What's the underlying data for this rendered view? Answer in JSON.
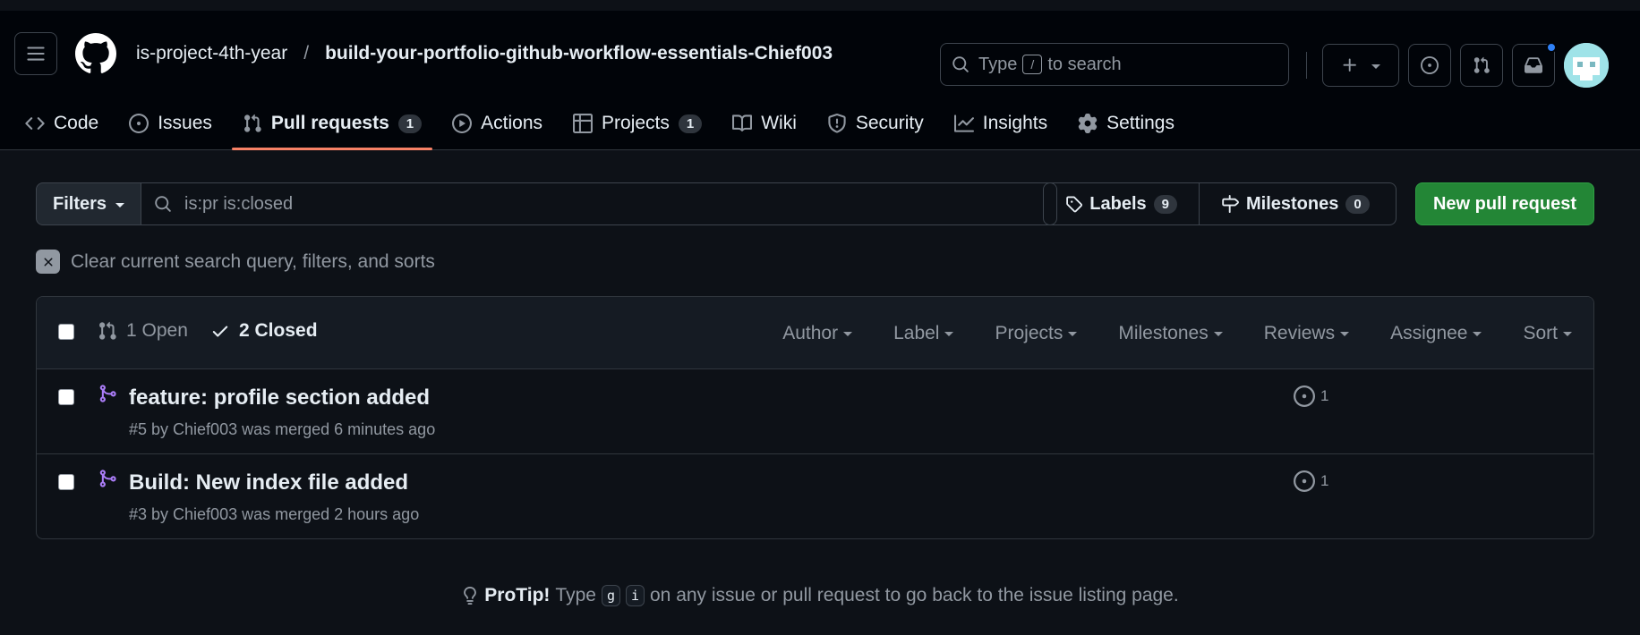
{
  "header": {
    "org": "is-project-4th-year",
    "separator": "/",
    "repo": "build-your-portfolio-github-workflow-essentials-Chief003",
    "search_prefix": "Type",
    "search_key": "/",
    "search_suffix": "to search"
  },
  "tabs": [
    {
      "label": "Code",
      "icon": "code-icon"
    },
    {
      "label": "Issues",
      "icon": "issue-icon"
    },
    {
      "label": "Pull requests",
      "icon": "pull-request-icon",
      "count": "1",
      "active": true
    },
    {
      "label": "Actions",
      "icon": "play-icon"
    },
    {
      "label": "Projects",
      "icon": "table-icon",
      "count": "1"
    },
    {
      "label": "Wiki",
      "icon": "book-icon"
    },
    {
      "label": "Security",
      "icon": "shield-icon"
    },
    {
      "label": "Insights",
      "icon": "graph-icon"
    },
    {
      "label": "Settings",
      "icon": "gear-icon"
    }
  ],
  "filters": {
    "button_label": "Filters",
    "query": "is:pr is:closed",
    "labels_label": "Labels",
    "labels_count": "9",
    "milestones_label": "Milestones",
    "milestones_count": "0",
    "new_pr_label": "New pull request",
    "clear_label": "Clear current search query, filters, and sorts"
  },
  "list": {
    "open_label": "1 Open",
    "closed_label": "2 Closed",
    "dropdowns": [
      "Author",
      "Label",
      "Projects",
      "Milestones",
      "Reviews",
      "Assignee",
      "Sort"
    ],
    "items": [
      {
        "title": "feature: profile section added",
        "meta": "#5 by Chief003 was merged 6 minutes ago",
        "comments": "1"
      },
      {
        "title": "Build: New index file added",
        "meta": "#3 by Chief003 was merged 2 hours ago",
        "comments": "1"
      }
    ]
  },
  "protip": {
    "label": "ProTip!",
    "pre": "Type",
    "key1": "g",
    "key2": "i",
    "post": "on any issue or pull request to go back to the issue listing page."
  },
  "colors": {
    "accent_tab_underline": "#f78166",
    "new_pr_green": "#238636",
    "merged_purple": "#ab7df8"
  }
}
